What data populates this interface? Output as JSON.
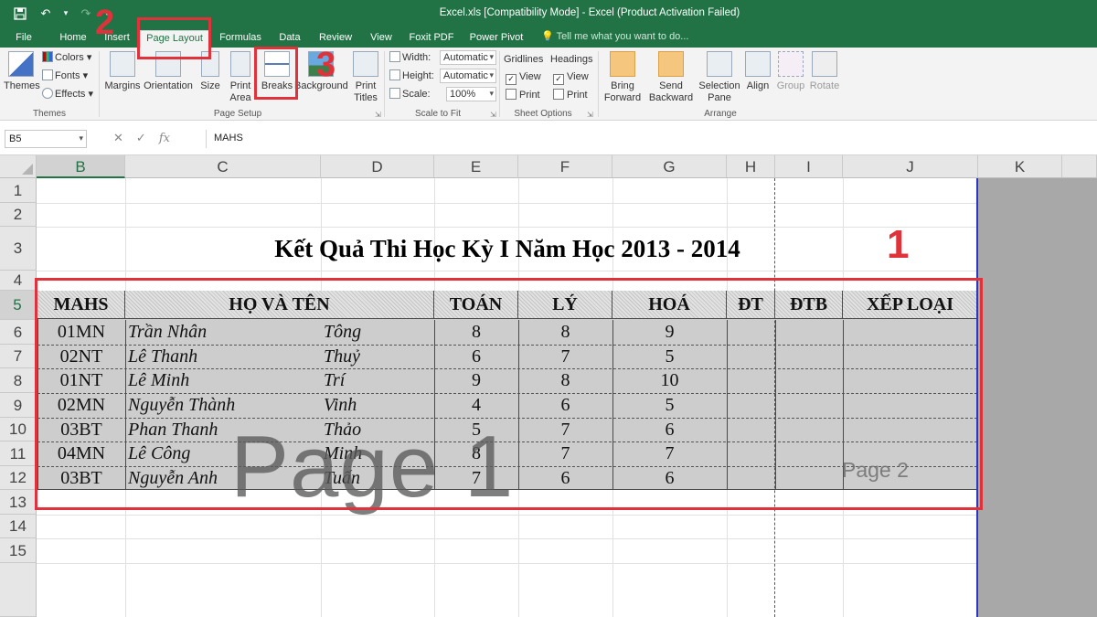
{
  "titlebar": {
    "title": "Excel.xls  [Compatibility Mode] - Excel (Product Activation Failed)",
    "qat_icons": [
      "save-icon",
      "undo-icon",
      "redo-icon",
      "customize-icon"
    ]
  },
  "tabs": [
    "File",
    "Home",
    "Insert",
    "Page Layout",
    "Formulas",
    "Data",
    "Review",
    "View",
    "Foxit PDF",
    "Power Pivot"
  ],
  "tell_me": "Tell me what you want to do...",
  "ribbon": {
    "themes": {
      "themes_btn": "Themes",
      "colors": "Colors",
      "fonts": "Fonts",
      "effects": "Effects",
      "label": "Themes"
    },
    "page_setup": {
      "margins": "Margins",
      "orientation": "Orientation",
      "size": "Size",
      "print_area_1": "Print",
      "print_area_2": "Area",
      "breaks": "Breaks",
      "background": "Background",
      "print_titles_1": "Print",
      "print_titles_2": "Titles",
      "label": "Page Setup"
    },
    "scale_to_fit": {
      "width_label": "Width:",
      "width_value": "Automatic",
      "height_label": "Height:",
      "height_value": "Automatic",
      "scale_label": "Scale:",
      "scale_value": "100%",
      "label": "Scale to Fit"
    },
    "sheet_options": {
      "gridlines": "Gridlines",
      "headings": "Headings",
      "view": "View",
      "print": "Print",
      "label": "Sheet Options"
    },
    "arrange": {
      "bring_forward_1": "Bring",
      "bring_forward_2": "Forward",
      "send_backward_1": "Send",
      "send_backward_2": "Backward",
      "selection_pane_1": "Selection",
      "selection_pane_2": "Pane",
      "align": "Align",
      "group": "Group",
      "rotate": "Rotate",
      "label": "Arrange"
    }
  },
  "formula_bar": {
    "name_box": "B5",
    "content": "MAHS"
  },
  "columns": [
    "B",
    "C",
    "D",
    "E",
    "F",
    "G",
    "H",
    "I",
    "J",
    "K"
  ],
  "rows": [
    "1",
    "2",
    "3",
    "4",
    "5",
    "6",
    "7",
    "8",
    "9",
    "10",
    "11",
    "12",
    "13",
    "14",
    "15"
  ],
  "sheet": {
    "title": "Kết Quả Thi Học Kỳ I Năm Học 2013 - 2014",
    "headers": [
      "MAHS",
      "HỌ VÀ TÊN",
      "TOÁN",
      "LÝ",
      "HOÁ",
      "ĐT",
      "ĐTB",
      "XẾP LOẠI"
    ],
    "students": [
      {
        "mahs": "01MN",
        "ho": "Trần Nhân",
        "ten": "Tông",
        "toan": "8",
        "ly": "8",
        "hoa": "9"
      },
      {
        "mahs": "02NT",
        "ho": "Lê Thanh",
        "ten": "Thuỷ",
        "toan": "6",
        "ly": "7",
        "hoa": "5"
      },
      {
        "mahs": "01NT",
        "ho": "Lê Minh",
        "ten": "Trí",
        "toan": "9",
        "ly": "8",
        "hoa": "10"
      },
      {
        "mahs": "02MN",
        "ho": "Nguyễn Thành",
        "ten": "Vinh",
        "toan": "4",
        "ly": "6",
        "hoa": "5"
      },
      {
        "mahs": "03BT",
        "ho": "Phan Thanh",
        "ten": "Thảo",
        "toan": "5",
        "ly": "7",
        "hoa": "6"
      },
      {
        "mahs": "04MN",
        "ho": "Lê Công",
        "ten": "Minh",
        "toan": "8",
        "ly": "7",
        "hoa": "7"
      },
      {
        "mahs": "03BT",
        "ho": "Nguyễn Anh",
        "ten": "Tuấn",
        "toan": "7",
        "ly": "6",
        "hoa": "6"
      }
    ],
    "watermark_page1": "Page 1",
    "watermark_page2": "Page 2"
  },
  "annotations": {
    "step1": "1",
    "step2": "2",
    "step3": "3",
    "color": "#e0323a"
  },
  "colors": {
    "excel_green": "#217346",
    "page_break_blue": "#3b50c8"
  }
}
